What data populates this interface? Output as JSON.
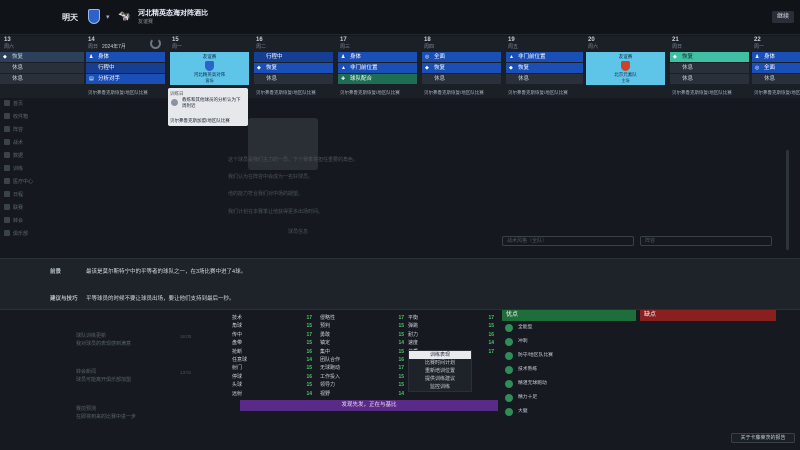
{
  "topbar": {
    "tomorrow": "明天",
    "match_title": "河北精英态海对阵酒比",
    "match_sub": "友谊赛",
    "continue": "继续"
  },
  "calendar": {
    "month_label": "2024年7月",
    "days": [
      {
        "num": "13",
        "name": "周六"
      },
      {
        "num": "14",
        "name": "周日"
      },
      {
        "num": "15",
        "name": "周一"
      },
      {
        "num": "16",
        "name": "周二"
      },
      {
        "num": "17",
        "name": "周三"
      },
      {
        "num": "18",
        "name": "周四"
      },
      {
        "num": "19",
        "name": "周五"
      },
      {
        "num": "20",
        "name": "周六"
      },
      {
        "num": "21",
        "name": "周日"
      },
      {
        "num": "22",
        "name": "周一"
      }
    ],
    "day14": [
      "身体",
      "行程中",
      "分析对手"
    ],
    "day16": [
      "行程中",
      "恢复",
      "休息"
    ],
    "day17": [
      "身体",
      "非门前位置",
      "球队配合"
    ],
    "day18": [
      "全面",
      "恢复",
      "休息"
    ],
    "day19": [
      "非门前位置",
      "恢复",
      "休息"
    ],
    "day21": [
      "恢复",
      "休息",
      "休息"
    ],
    "day22": [
      "身体",
      "全面",
      "休息"
    ],
    "day13": [
      "恢复",
      "休息",
      "休息"
    ],
    "match15": {
      "top": "友谊赛",
      "name": "河北精英高对阵",
      "sub": "客场"
    },
    "match20": {
      "top": "友谊赛",
      "name": "北京元素队",
      "sub": "主场"
    },
    "foot": "贝尔弗鲁克斯恢复/地区队比赛"
  },
  "popup": {
    "line1": "训练日",
    "line2": "教练和其他球员的分析认为下周附近",
    "line3": "训练",
    "line4": "贝尔弗鲁克斯加盟/地区队比赛"
  },
  "sidebar": {
    "items": [
      "首页",
      "收件箱",
      "阵容",
      "战术",
      "数据",
      "训练",
      "医疗中心",
      "日程",
      "联赛",
      "转会",
      "俱乐部"
    ]
  },
  "bg": {
    "lines": [
      "这个球员是我们主力的一员，下个赛季将担任重要的角色。",
      "我们认为在阵容中会成为一名好球员。",
      "他的能力符合我们对中场的期望。",
      "我们计划在本赛季让他获得更多出场时间。"
    ],
    "select1": "战术风格（全队）",
    "select2": "阵容",
    "name_label": "球员信息"
  },
  "tips": {
    "label1": "前景",
    "text1": "最该是莫尔斯特宁中的平等者的球队之一，在3场比赛中进了4球。",
    "label2": "建议与技巧",
    "text2": "平等球员的时候不要让球员出场，要让他们支持到最后一秒。"
  },
  "news": [
    {
      "title": "球队训练更新",
      "body": "我对球员的表现感到满意",
      "time": "16:00"
    },
    {
      "title": "转会新闻",
      "body": "球员可能离开俱乐部加盟",
      "time": "13:01"
    },
    {
      "title": "赛前预测",
      "body": "在即将到来的比赛中进一步",
      "time": ""
    }
  ],
  "attrs": {
    "col1": [
      [
        "技术",
        "17"
      ],
      [
        "角球",
        "15"
      ],
      [
        "传中",
        "17"
      ],
      [
        "盘带",
        "15"
      ],
      [
        "抢断",
        "16"
      ],
      [
        "任意球",
        "14"
      ],
      [
        "射门",
        "15"
      ],
      [
        "停球",
        "16"
      ],
      [
        "头球",
        "15"
      ],
      [
        "远射",
        "14"
      ]
    ],
    "col2": [
      [
        "侵略性",
        "17"
      ],
      [
        "预判",
        "15"
      ],
      [
        "勇敢",
        "15"
      ],
      [
        "镇定",
        "14"
      ],
      [
        "集中",
        "15"
      ],
      [
        "团队合作",
        "16"
      ],
      [
        "无球跑动",
        "17"
      ],
      [
        "工作投入",
        "15"
      ],
      [
        "领导力",
        "15"
      ],
      [
        "视野",
        "14"
      ]
    ],
    "col3": [
      [
        "平衡",
        "17"
      ],
      [
        "弹跳",
        "15"
      ],
      [
        "耐力",
        "16"
      ],
      [
        "速度",
        "14"
      ],
      [
        "体质",
        "17"
      ]
    ],
    "cta": "发现先发，正在与基比",
    "popup_items": [
      "训练表现",
      "比赛时间计划",
      "重新培训位置",
      "提供训练建议",
      "监控训练"
    ],
    "popup_hl": "训练表现"
  },
  "pros": {
    "head": "优点",
    "items": [
      "全能型",
      "冲刺",
      "防守/地区队比赛",
      "技术熟练",
      "精湛无球跑动",
      "精力十足",
      "大腿"
    ]
  },
  "cons": {
    "head": "缺点"
  },
  "about_link": "关于卡藤莱茨的报告"
}
